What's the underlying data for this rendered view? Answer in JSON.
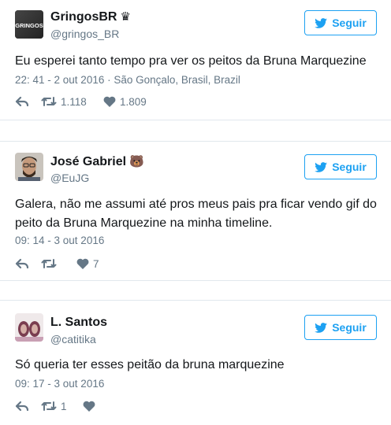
{
  "colors": {
    "accent": "#1da1f2",
    "text": "#14171a",
    "muted": "#657786",
    "divider": "#e1e8ed"
  },
  "tweets": [
    {
      "name": "GringosBR",
      "badge": "♛",
      "handle": "@gringos_BR",
      "follow_label": "Seguir",
      "text": "Eu esperei tanto tempo pra ver os peitos da Bruna Marquezine",
      "timestamp": "22: 41 - 2 out 2016",
      "location": " · São Gonçalo, Brasil, Brazil",
      "retweets": "1.118",
      "likes": "1.809",
      "avatar_text": "GRINGOS"
    },
    {
      "name": "José Gabriel",
      "badge": "🐻",
      "handle": "@EuJG",
      "follow_label": "Seguir",
      "text": "Galera, não me assumi até pros meus pais pra ficar vendo gif do peito da Bruna Marquezine na minha timeline.",
      "timestamp": "09: 14 - 3 out 2016",
      "retweets": "",
      "likes": "7"
    },
    {
      "name": "L. Santos",
      "handle": "@catitika",
      "follow_label": "Seguir",
      "text": "Só queria ter esses peitão da bruna marquezine",
      "timestamp": "09: 17 - 3 out 2016",
      "retweets": "1",
      "likes": ""
    }
  ]
}
